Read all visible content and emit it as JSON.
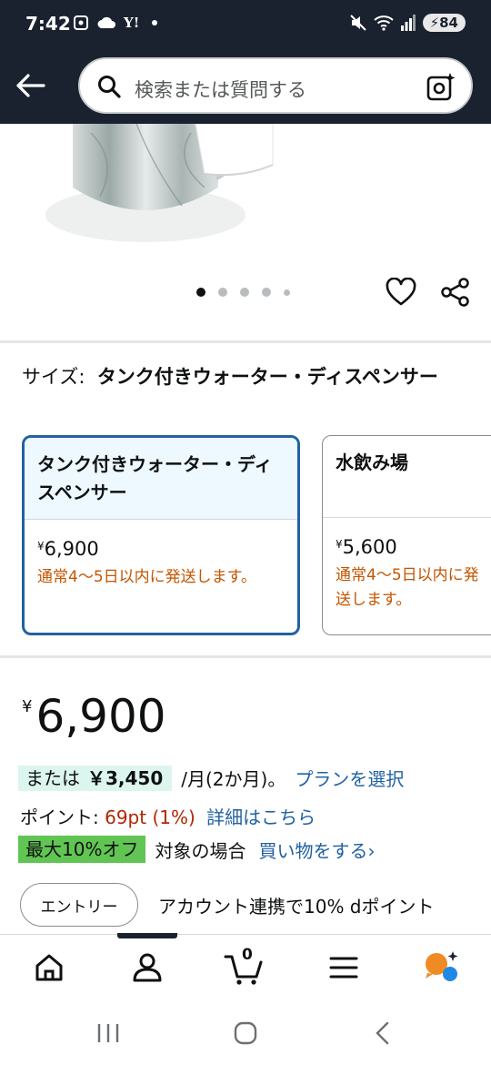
{
  "status_bar": {
    "time": "7:42",
    "left_icons": [
      "screenshot-icon",
      "cloud-icon",
      "yahoo-icon",
      "dot-icon"
    ],
    "yahoo_text": "Y!",
    "battery": "84",
    "right_icons": [
      "mute-icon",
      "wifi-icon",
      "signal-icon",
      "battery-icon"
    ]
  },
  "header": {
    "search_placeholder": "検索または質問する"
  },
  "product": {
    "carousel_dots": 5,
    "active_dot": 0
  },
  "size": {
    "label": "サイズ:",
    "value": "タンク付きウォーター・ディスペンサー"
  },
  "variants": [
    {
      "name": "タンク付きウォーター・ディスペンサー",
      "currency": "¥",
      "price": "6,900",
      "shipping": "通常4～5日以内に発送します。",
      "selected": true
    },
    {
      "name": "水飲み場",
      "currency": "¥",
      "price": "5,600",
      "shipping": "通常4～5日以内に発送します。",
      "selected": false
    }
  ],
  "price": {
    "currency": "¥",
    "amount": "6,900"
  },
  "installment": {
    "prefix": "または",
    "amount": "￥3,450",
    "suffix": "/月(2か月)。",
    "link": "プランを選択"
  },
  "points": {
    "label": "ポイント:",
    "value": "69pt",
    "percent": "(1%)",
    "link": "詳細はこちら"
  },
  "promo": {
    "badge": "最大10%オフ",
    "text": "対象の場合",
    "link": "買い物をする›"
  },
  "entry": {
    "button": "エントリー",
    "text": "アカウント連携で10% dポイント"
  },
  "bottom_nav": {
    "items": [
      "home-icon",
      "account-icon",
      "cart-icon",
      "menu-icon",
      "rufus-icon"
    ],
    "cart_count": "0",
    "active": "account"
  },
  "colors": {
    "header_bg": "#1a2230",
    "link": "#2162a1",
    "price_red": "#b12704",
    "shipping_orange": "#c45500",
    "promo_green": "#61c553",
    "installment_bg": "#dcf5ef",
    "selected_border": "#2162a1"
  }
}
